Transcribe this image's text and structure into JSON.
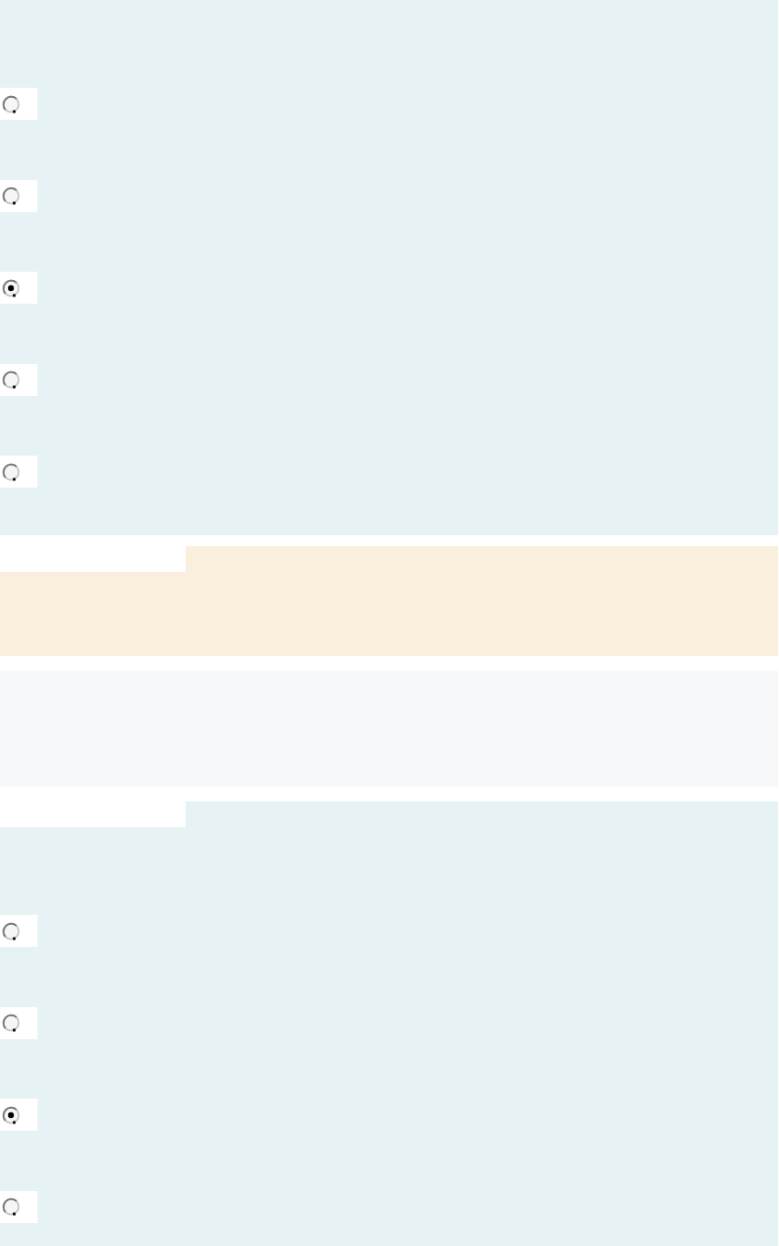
{
  "sections": [
    {
      "kind": "question",
      "tabbed": false,
      "options": [
        {
          "selected": false
        },
        {
          "selected": false
        },
        {
          "selected": true
        },
        {
          "selected": false
        },
        {
          "selected": false
        }
      ]
    },
    {
      "kind": "notice",
      "tabbed": true
    },
    {
      "kind": "info",
      "tabbed": false
    },
    {
      "kind": "question",
      "tabbed": true,
      "options": [
        {
          "selected": false
        },
        {
          "selected": false
        },
        {
          "selected": true
        },
        {
          "selected": false
        }
      ]
    }
  ]
}
